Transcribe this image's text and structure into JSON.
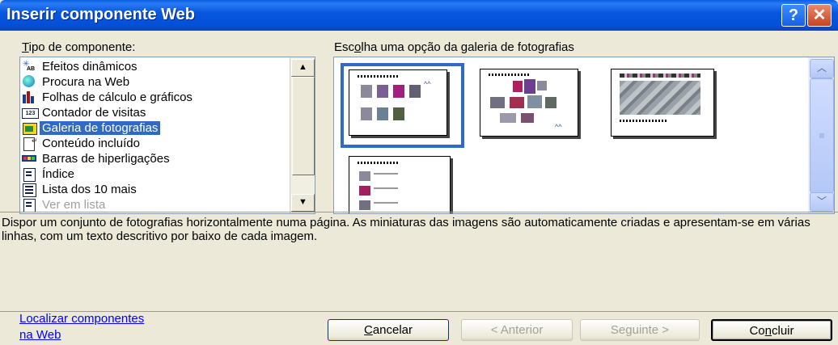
{
  "window": {
    "title": "Inserir componente Web",
    "help_glyph": "?",
    "close_glyph": "✕"
  },
  "component_type": {
    "label_prefix": "T",
    "label_rest": "ipo de componente:",
    "items": [
      {
        "label": "Efeitos dinâmicos",
        "icon": "dynamic-effects-icon"
      },
      {
        "label": "Procura na Web",
        "icon": "web-search-icon"
      },
      {
        "label": "Folhas de cálculo e gráficos",
        "icon": "spreadsheet-chart-icon"
      },
      {
        "label": "Contador de visitas",
        "icon": "hit-counter-icon"
      },
      {
        "label": "Galeria de fotografias",
        "icon": "photo-gallery-icon"
      },
      {
        "label": "Conteúdo incluído",
        "icon": "included-content-icon"
      },
      {
        "label": "Barras de hiperligações",
        "icon": "link-bar-icon"
      },
      {
        "label": "Índice",
        "icon": "index-icon"
      },
      {
        "label": "Lista dos 10 mais",
        "icon": "top-ten-list-icon"
      },
      {
        "label": "Ver em lista",
        "icon": "list-view-icon"
      }
    ],
    "selected_index": 4
  },
  "gallery": {
    "label_pre": "Esc",
    "label_accel": "o",
    "label_post": "lha uma opção da galeria de fotografias",
    "selected_index": 0
  },
  "description": "Dispor um conjunto de fotografias horizontalmente numa página. As miniaturas das imagens são automaticamente criadas e apresentam-se em várias linhas, com um texto descritivo por baixo de cada imagem.",
  "footer": {
    "link_line1": "Localizar componentes",
    "link_line2": "na Web",
    "cancel_accel": "C",
    "cancel_rest": "ancelar",
    "back": "< Anterior",
    "next": "Seguinte >",
    "finish_pre": "Co",
    "finish_accel": "n",
    "finish_post": "cluir"
  },
  "colors": {
    "selection": "#316ac5",
    "titlebar": "#0857e0",
    "link": "#0000ff"
  }
}
